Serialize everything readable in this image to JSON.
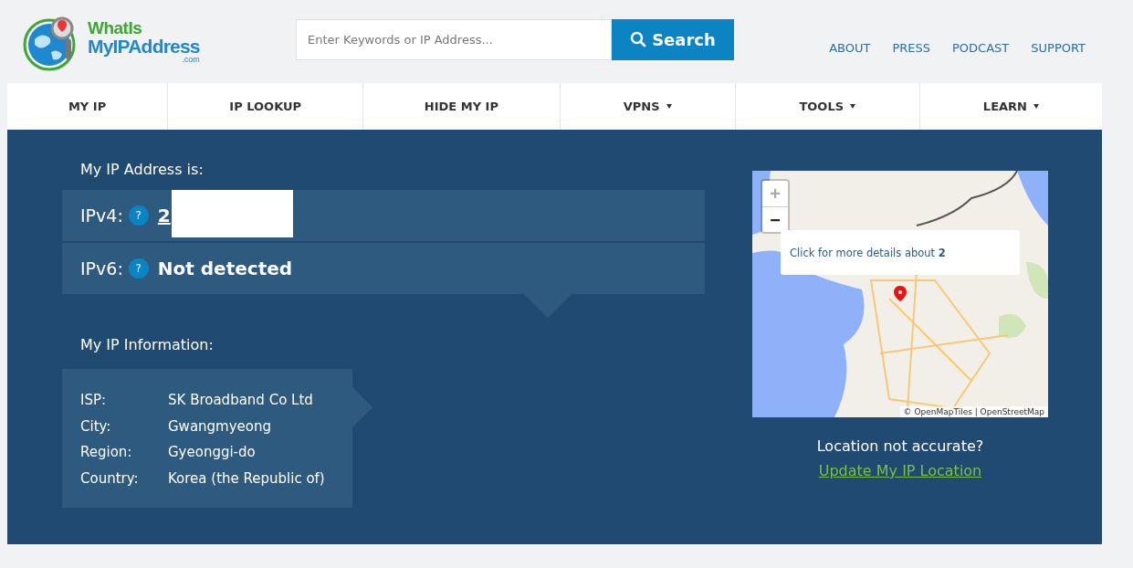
{
  "logo": {
    "line_1": "WhatIs",
    "line_2": "MyIPAddress",
    "line_3": ".com"
  },
  "search": {
    "placeholder": "Enter Keywords or IP Address...",
    "button": "Search"
  },
  "top_links": [
    "ABOUT",
    "PRESS",
    "PODCAST",
    "SUPPORT"
  ],
  "nav": [
    {
      "label": "MY IP",
      "dropdown": false
    },
    {
      "label": "IP LOOKUP",
      "dropdown": false
    },
    {
      "label": "HIDE MY IP",
      "dropdown": false
    },
    {
      "label": "VPNS",
      "dropdown": true
    },
    {
      "label": "TOOLS",
      "dropdown": true
    },
    {
      "label": "LEARN",
      "dropdown": true
    }
  ],
  "ip_heading": "My IP Address is:",
  "ip_rows": [
    {
      "label": "IPv4:",
      "help": "?",
      "value_start": "2",
      "redacted": true,
      "link": true
    },
    {
      "label": "IPv6:",
      "help": "?",
      "value_start": "Not detected",
      "redacted": false,
      "link": false
    }
  ],
  "info_heading": "My IP Information:",
  "info": [
    {
      "label": "ISP:",
      "value": "SK Broadband Co Ltd"
    },
    {
      "label": "City:",
      "value": "Gwangmyeong"
    },
    {
      "label": "Region:",
      "value": "Gyeonggi-do"
    },
    {
      "label": "Country:",
      "value": "Korea (the Republic of)"
    }
  ],
  "map": {
    "zoom_in": "+",
    "zoom_out": "−",
    "popup": "Click for more details about **2**",
    "attribution": "© OpenMapTiles | OpenStreetMap"
  },
  "location_question": "Location not accurate?",
  "update_link": "Update My IP Location"
}
